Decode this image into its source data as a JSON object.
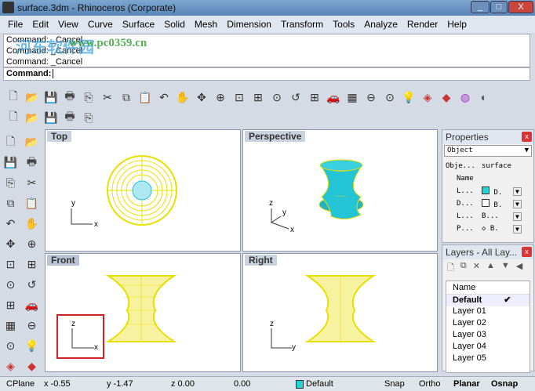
{
  "window": {
    "title": "surface.3dm - Rhinoceros (Corporate)",
    "controls": [
      "_",
      "□",
      "X"
    ]
  },
  "watermark": {
    "text": "河东软件园",
    "url": "www.pc0359.cn"
  },
  "menu": [
    "File",
    "Edit",
    "View",
    "Curve",
    "Surface",
    "Solid",
    "Mesh",
    "Dimension",
    "Transform",
    "Tools",
    "Analyze",
    "Render",
    "Help"
  ],
  "command": {
    "history": [
      "Command: _Cancel",
      "Command: _Cancel",
      "Command: _Cancel"
    ],
    "prompt": "Command:",
    "value": ""
  },
  "toolbar_main": [
    "new-icon",
    "open-icon",
    "save-icon",
    "print-icon",
    "import-icon",
    "cut-icon",
    "copy-icon",
    "paste-icon",
    "undo-icon",
    "pan-hand-icon",
    "rotate-view-icon",
    "zoom-dynamic-icon",
    "zoom-window-icon",
    "zoom-extents-icon",
    "zoom-selected-icon",
    "undo-view-icon",
    "four-viewports-icon",
    "car-icon",
    "grid-icon",
    "osnap-icon",
    "properties-icon",
    "light-icon",
    "layer-icon",
    "render-icon",
    "color-wheel-icon",
    "sphere-icon"
  ],
  "toolbar_second": [
    "render-preview-icon",
    "material-icon",
    "render-settings-icon",
    "viewport-layout-icon",
    "options-icon"
  ],
  "toolbar_left": [
    "select-icon",
    "point-icon",
    "polyline-icon",
    "curve-point-icon",
    "circle-icon",
    "arc-icon",
    "curve-icon",
    "rectangle-icon",
    "polygon-icon",
    "fillet-icon",
    "surface-icon",
    "extrude-icon",
    "box-solid-icon",
    "sphere-solid-icon",
    "mesh-icon",
    "mesh-plane-icon",
    "transform-icon",
    "boolean-icon",
    "dimension-icon",
    "text-icon",
    "group-icon",
    "array-icon",
    "join-icon",
    "explode-icon"
  ],
  "viewports": [
    {
      "name": "Top",
      "axes": [
        "y",
        "x"
      ]
    },
    {
      "name": "Perspective",
      "axes": [
        "z",
        "y",
        "x"
      ]
    },
    {
      "name": "Front",
      "axes": [
        "z",
        "x"
      ]
    },
    {
      "name": "Right",
      "axes": [
        "z",
        "y"
      ]
    }
  ],
  "properties": {
    "title": "Properties",
    "select": "Object",
    "rows": [
      [
        "Obje...",
        "surface"
      ],
      [
        "Name",
        ""
      ],
      [
        "L...",
        "D."
      ],
      [
        "D...",
        "B."
      ],
      [
        "L...",
        "B..."
      ],
      [
        "P...",
        "B."
      ]
    ]
  },
  "layers": {
    "title": "Layers - All Lay...",
    "column": "Name",
    "items": [
      {
        "name": "Default",
        "current": true
      },
      {
        "name": "Layer 01"
      },
      {
        "name": "Layer 02"
      },
      {
        "name": "Layer 03"
      },
      {
        "name": "Layer 04"
      },
      {
        "name": "Layer 05"
      }
    ],
    "check": "✔"
  },
  "status": {
    "cplane": "CPlane",
    "x": "x -0.55",
    "y": "y -1.47",
    "z": "z 0.00",
    "d": "0.00",
    "layer": "Default",
    "snap": "Snap",
    "ortho": "Ortho",
    "planar": "Planar",
    "osnap": "Osnap"
  },
  "colors": {
    "surface": "#22c4d6",
    "wire": "#f0e800",
    "layer": "#22d4d4",
    "highlight": "#cc2222"
  }
}
